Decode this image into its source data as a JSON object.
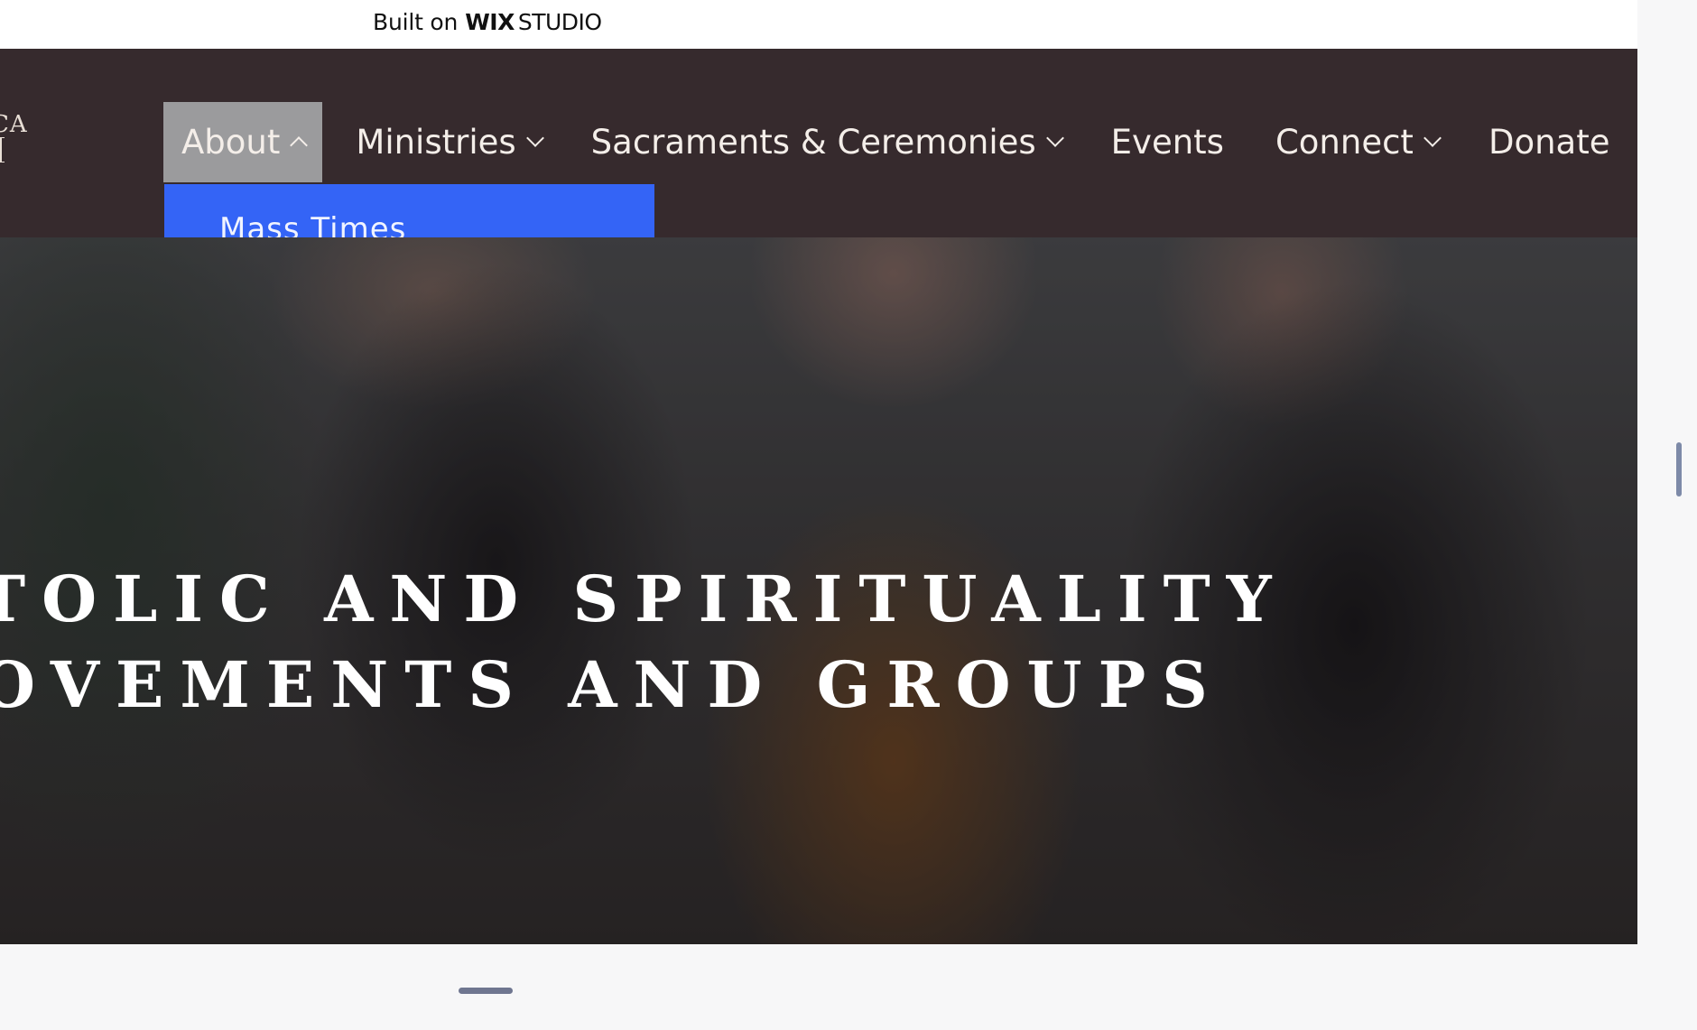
{
  "banner": {
    "built_on": "Built on",
    "wix": "WIX",
    "studio": "STUDIO"
  },
  "logo": {
    "fragment": "CA"
  },
  "nav": {
    "items": [
      {
        "label": "About",
        "has_chevron": true,
        "active": true
      },
      {
        "label": "Ministries",
        "has_chevron": true
      },
      {
        "label": "Sacraments & Ceremonies",
        "has_chevron": true
      },
      {
        "label": "Events",
        "has_chevron": false
      },
      {
        "label": "Connect",
        "has_chevron": true
      },
      {
        "label": "Donate",
        "has_chevron": false
      }
    ],
    "dropdown": {
      "items": [
        {
          "label": "Mass Times"
        }
      ]
    }
  },
  "hero": {
    "title_line1": "TOLIC AND SPIRITUALITY",
    "title_line2": "OVEMENTS AND GROUPS"
  },
  "colors": {
    "header_bg": "#362a2d",
    "active_nav_bg": "#9b9b9d",
    "dropdown_bg": "#3464f6",
    "page_bg": "#f7f7f8"
  }
}
